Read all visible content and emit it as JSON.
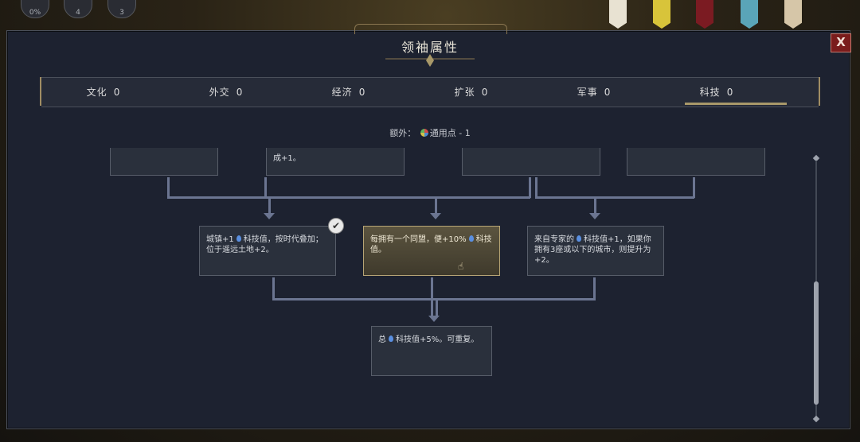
{
  "hud": {
    "stats": [
      "0%",
      "4",
      "3"
    ]
  },
  "dialog": {
    "title": "领袖属性",
    "close_label": "X"
  },
  "tabs": [
    {
      "label": "文化",
      "value": "0"
    },
    {
      "label": "外交",
      "value": "0"
    },
    {
      "label": "经济",
      "value": "0"
    },
    {
      "label": "扩张",
      "value": "0"
    },
    {
      "label": "军事",
      "value": "0"
    },
    {
      "label": "科技",
      "value": "0"
    }
  ],
  "selected_tab": "科技",
  "extra": {
    "prefix": "额外：",
    "label": "通用点",
    "value": "- 1"
  },
  "tree": {
    "top_partial_text": "成+1。",
    "nodes": {
      "n1_a": "城镇+1",
      "n1_b": "科技值，按时代叠加；位于遥远土地+2。",
      "n2_a": "每拥有一个同盟，便+10%",
      "n2_b": "科技值。",
      "n3_a": "来自专家的",
      "n3_b": "科技值+1，如果你拥有3座或以下的城市，则提升为+2。",
      "n4_a": "总",
      "n4_b": "科技值+5%。可重复。"
    }
  },
  "colors": {
    "panel_bg": "#1d2230",
    "accent_gold": "#a89869",
    "close_red": "#7a1c1c",
    "connector": "#6b7591"
  }
}
